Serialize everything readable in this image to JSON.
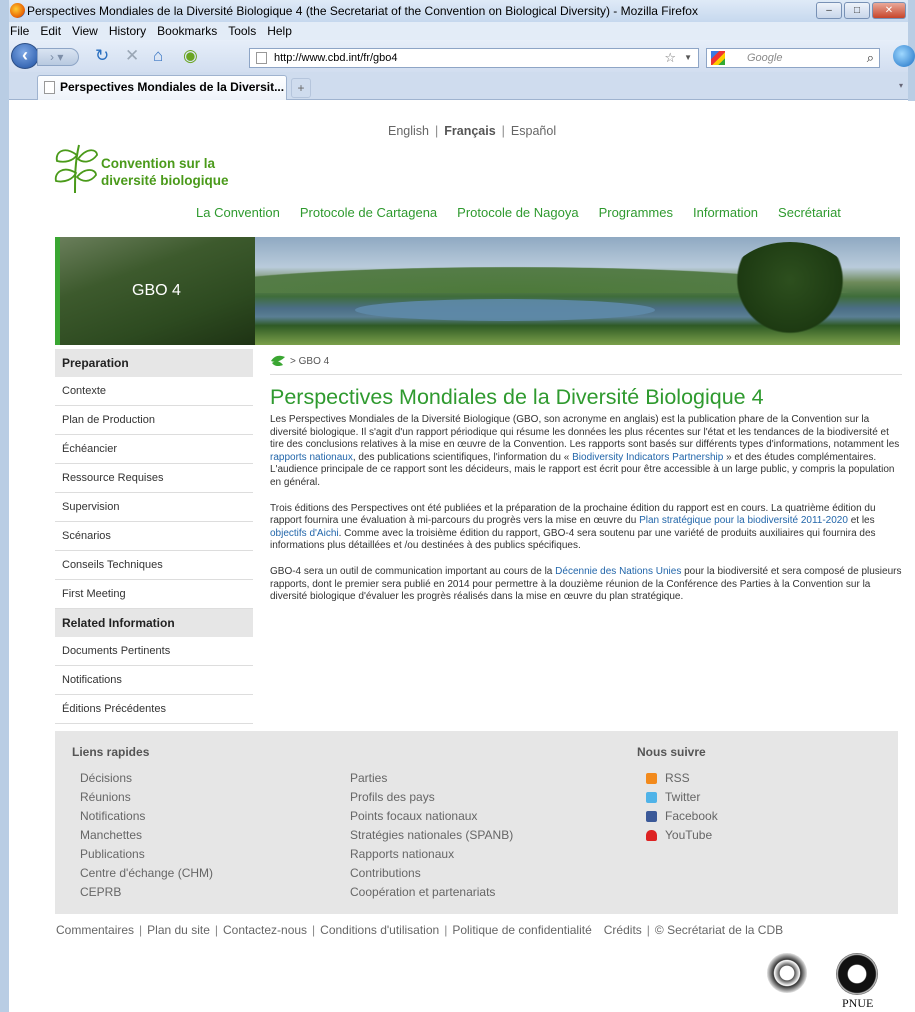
{
  "window": {
    "title": "Perspectives Mondiales de la Diversité Biologique 4 (the Secretariat of the Convention on Biological Diversity) - Mozilla Firefox",
    "menu": [
      "File",
      "Edit",
      "View",
      "History",
      "Bookmarks",
      "Tools",
      "Help"
    ],
    "url": "http://www.cbd.int/fr/gbo4",
    "search_placeholder": "Google",
    "tab_title": "Perspectives Mondiales de la Diversit...",
    "new_tab": "+"
  },
  "page": {
    "languages": {
      "en": "English",
      "fr": "Français",
      "es": "Español"
    },
    "logo": {
      "line1": "Convention sur la",
      "line2": "diversité biologique"
    },
    "nav": [
      "La Convention",
      "Protocole de Cartagena",
      "Protocole de Nagoya",
      "Programmes",
      "Information",
      "Secrétariat"
    ],
    "banner_title": "GBO 4",
    "sidebar": {
      "heading1": "Preparation",
      "items1": [
        "Contexte",
        "Plan de Production",
        "Échéancier",
        "Ressource Requises",
        "Supervision",
        "Scénarios",
        "Conseils Techniques",
        "First Meeting"
      ],
      "heading2": "Related Information",
      "items2": [
        "Documents Pertinents",
        "Notifications",
        "Éditions Précédentes"
      ]
    },
    "breadcrumb": "> GBO 4",
    "heading": "Perspectives Mondiales de la Diversité Biologique 4",
    "p1": {
      "a": "Les Perspectives Mondiales de la Diversité Biologique (GBO, son acronyme en anglais) est la publication phare de la Convention sur la diversité biologique. Il s'agit d'un rapport périodique qui résume les données les plus récentes sur l'état et les tendances de la biodiversité et tire des conclusions relatives à la mise en œuvre de la Convention. Les rapports sont basés sur différents types d'informations, notamment les ",
      "link1": "rapports nationaux",
      "b": ", des publications scientifiques, l'information du « ",
      "link2": "Biodiversity Indicators Partnership",
      "c": " » et des études complémentaires. L'audience principale de ce rapport sont les décideurs, mais le rapport est écrit pour être accessible à un large public, y compris la population en général."
    },
    "p2": {
      "a": "Trois éditions des Perspectives ont été publiées et la préparation de la prochaine édition du rapport est en cours. La quatrième édition du rapport fournira une évaluation à mi-parcours du progrès vers la mise en œuvre du ",
      "link1": "Plan stratégique pour la biodiversité 2011-2020",
      "b": " et les ",
      "link2": "objectifs d'Aichi",
      "c": ". Comme avec la troisième édition du rapport, GBO-4 sera soutenu par une variété de produits auxiliaires qui fournira des informations plus détaillées et /ou destinées à des publics spécifiques."
    },
    "p3": {
      "a": "GBO-4 sera un outil de communication important au cours de la ",
      "link1": "Décennie des Nations Unies",
      "b": " pour la biodiversité et sera composé de plusieurs rapports, dont le premier sera publié en 2014 pour permettre à la douzième réunion de la Conférence des Parties à la Convention sur la diversité biologique d'évaluer les progrès réalisés dans la mise en œuvre du plan stratégique."
    },
    "footer": {
      "quick_title": "Liens rapides",
      "col1": [
        "Décisions",
        "Réunions",
        "Notifications",
        "Manchettes",
        "Publications",
        "Centre d'échange (CHM)",
        "CEPRB"
      ],
      "col2": [
        "Parties",
        "Profils des pays",
        "Points focaux nationaux",
        "Stratégies nationales (SPANB)",
        "Rapports nationaux",
        "Contributions",
        "Coopération et partenariats"
      ],
      "follow_title": "Nous suivre",
      "social": [
        "RSS",
        "Twitter",
        "Facebook",
        "YouTube"
      ]
    },
    "bottom_links": [
      "Commentaires",
      "Plan du site",
      "Contactez-nous",
      "Conditions d'utilisation",
      "Politique de confidentialité",
      "Crédits",
      "© Secrétariat de la CDB"
    ],
    "pnue": "PNUE"
  },
  "colors": {
    "brand_green": "#2f9a2f",
    "link_blue": "#2266aa",
    "footer_bg": "#e6e6e6"
  }
}
